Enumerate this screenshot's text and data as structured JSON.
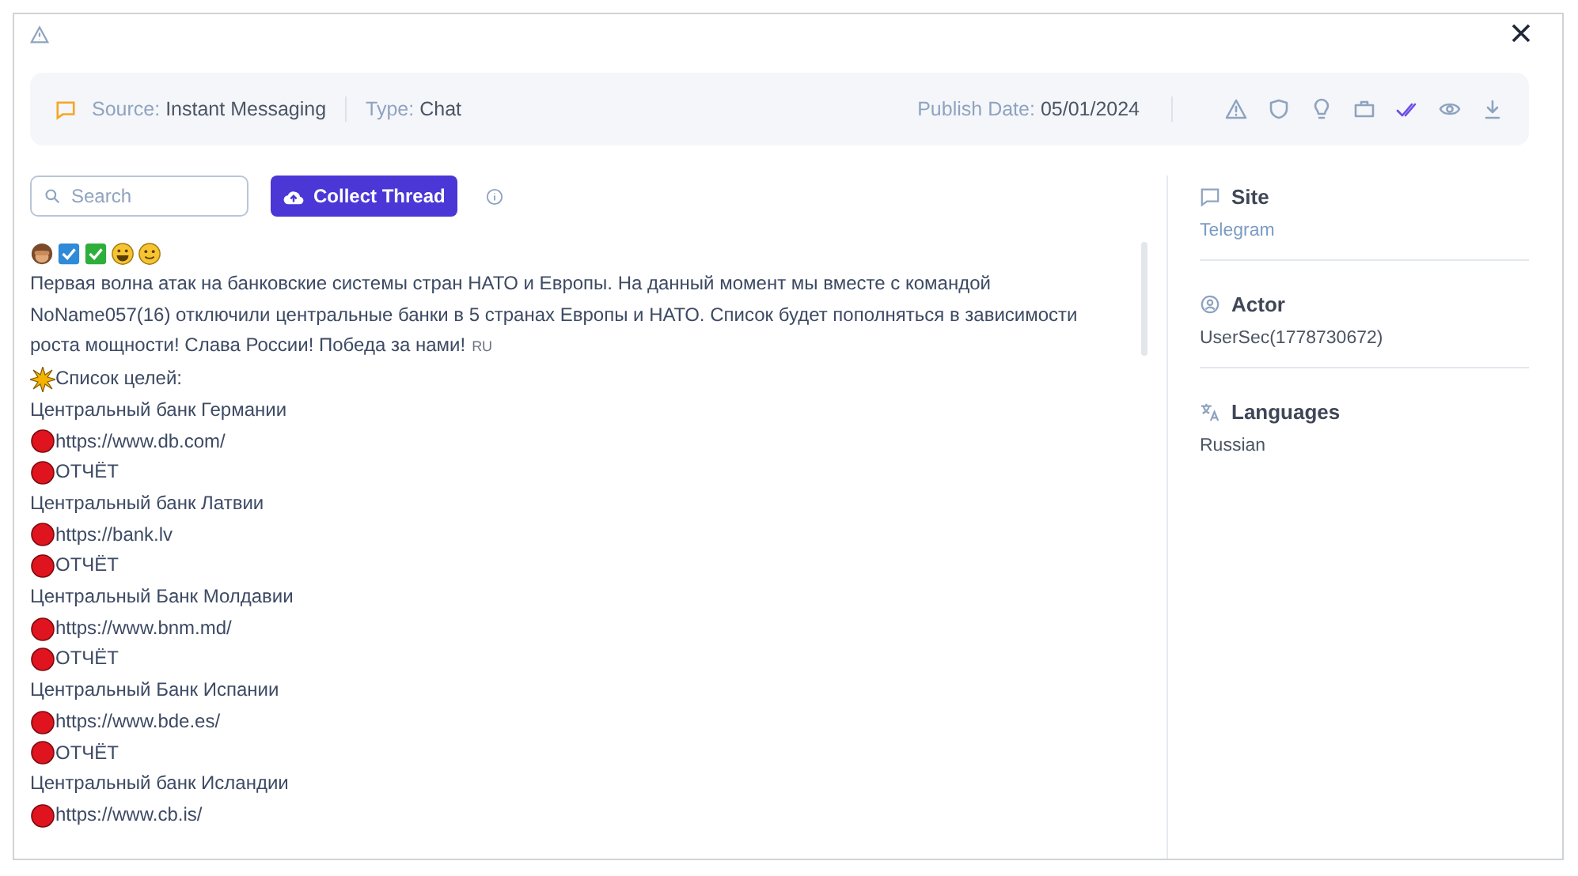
{
  "header": {
    "source_label": "Source:",
    "source": "Instant Messaging",
    "type_label": "Type:",
    "type": "Chat",
    "date_label": "Publish Date:",
    "date": "05/01/2024",
    "actions": [
      {
        "kind": "warning",
        "selected": false
      },
      {
        "kind": "shield",
        "selected": false
      },
      {
        "kind": "bulb",
        "selected": false
      },
      {
        "kind": "briefcase",
        "selected": false
      },
      {
        "kind": "double-check",
        "selected": true
      },
      {
        "kind": "eye",
        "selected": false
      },
      {
        "kind": "download",
        "selected": false
      }
    ]
  },
  "search": {
    "placeholder": "Search"
  },
  "collect_button": "Collect Thread",
  "message": [
    {
      "kind": "emoji_row"
    },
    {
      "kind": "paragraph",
      "text": "Первая волна атак на банковские системы стран НАТО и Европы. На данный момент мы вместе с командой NoName057(16) отключили центральные банки в 5 странах Европы и НАТО. Список будет пополняться в зависимости роста мощности! Слава России! Победа за нами!",
      "lang": "RU"
    },
    {
      "kind": "heading",
      "text": "Список целей:"
    },
    {
      "kind": "plain",
      "text": "Центральный банк Германии"
    },
    {
      "kind": "dot",
      "text": "https://www.db.com/"
    },
    {
      "kind": "dot",
      "text": "ОТЧЁТ"
    },
    {
      "kind": "plain",
      "text": "Центральный банк Латвии"
    },
    {
      "kind": "dot",
      "text": "https://bank.lv"
    },
    {
      "kind": "dot",
      "text": "ОТЧЁТ"
    },
    {
      "kind": "plain",
      "text": "Центральный Банк Молдавии"
    },
    {
      "kind": "dot",
      "text": "https://www.bnm.md/"
    },
    {
      "kind": "dot",
      "text": "ОТЧЁТ"
    },
    {
      "kind": "plain",
      "text": "Центральный Банк Испании"
    },
    {
      "kind": "dot",
      "text": "https://www.bde.es/"
    },
    {
      "kind": "dot",
      "text": "ОТЧЁТ"
    },
    {
      "kind": "plain",
      "text": "Центральный банк Исландии"
    },
    {
      "kind": "dot",
      "text": "https://www.cb.is/"
    }
  ],
  "details": [
    {
      "kind": "site",
      "label": "Site",
      "value": "Telegram"
    },
    {
      "kind": "actor",
      "label": "Actor",
      "value": "UserSec(1778730672)"
    },
    {
      "kind": "language",
      "label": "Languages",
      "value": "Russian"
    }
  ]
}
